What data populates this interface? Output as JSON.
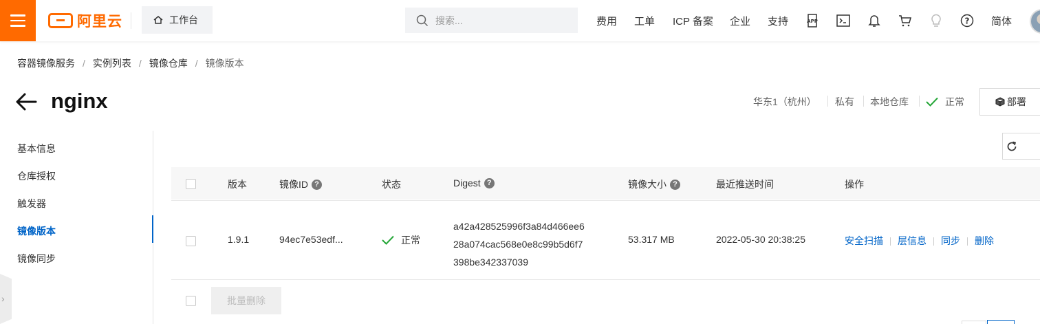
{
  "topbar": {
    "logo_text": "阿里云",
    "workbench_label": "工作台",
    "search_placeholder": "搜索...",
    "nav": [
      "费用",
      "工单",
      "ICP 备案",
      "企业",
      "支持"
    ],
    "language_label": "简体",
    "icons": [
      "app-icon",
      "terminal-icon",
      "bell-icon",
      "cart-icon",
      "lightbulb-icon",
      "help-icon"
    ]
  },
  "breadcrumb": [
    "容器镜像服务",
    "实例列表",
    "镜像仓库",
    "镜像版本"
  ],
  "page": {
    "title": "nginx",
    "region": "华东1（杭州）",
    "visibility": "私有",
    "repo_type": "本地仓库",
    "status": "正常",
    "deploy_label": "部署"
  },
  "sidebar": {
    "items": [
      {
        "label": "基本信息"
      },
      {
        "label": "仓库授权"
      },
      {
        "label": "触发器"
      },
      {
        "label": "镜像版本"
      },
      {
        "label": "镜像同步"
      }
    ],
    "active_index": 3
  },
  "table": {
    "headers": {
      "version": "版本",
      "image_id": "镜像ID",
      "status": "状态",
      "digest": "Digest",
      "size": "镜像大小",
      "push_time": "最近推送时间",
      "actions": "操作"
    },
    "rows": [
      {
        "version": "1.9.1",
        "image_id": "94ec7e53edf...",
        "status": "正常",
        "digest_lines": [
          "a42a428525996f3a84d466ee6",
          "28a074cac568e0e8c99b5d6f7",
          "398be342337039"
        ],
        "size": "53.317 MB",
        "push_time": "2022-05-30 20:38:25",
        "actions": [
          "安全扫描",
          "层信息",
          "同步",
          "删除"
        ]
      }
    ]
  },
  "bulk_delete_label": "批量删除",
  "colors": {
    "brand": "#ff6a00",
    "link": "#0064c8",
    "success": "#23a636"
  }
}
